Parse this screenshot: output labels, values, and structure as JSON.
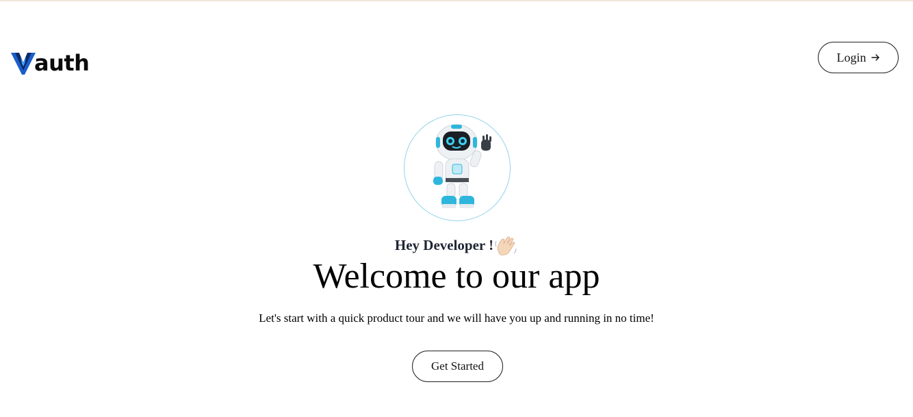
{
  "header": {
    "logo_text": "auth",
    "login_label": "Login",
    "login_icon": "arrow-right-icon"
  },
  "hero": {
    "avatar_icon": "robot-illustration",
    "greeting": "Hey Developer !",
    "greeting_emoji": "waving-hand-icon",
    "title": "Welcome to our app",
    "subtitle": "Let's start with a quick product tour and we will have you up and running in no time!",
    "cta_label": "Get Started"
  },
  "colors": {
    "logo_blue": "#1a5fc9",
    "logo_dark": "#0e2a6b",
    "avatar_border": "#8fd3ea",
    "robot_accent": "#2fb6dd",
    "top_rule": "#f1e6d8"
  }
}
